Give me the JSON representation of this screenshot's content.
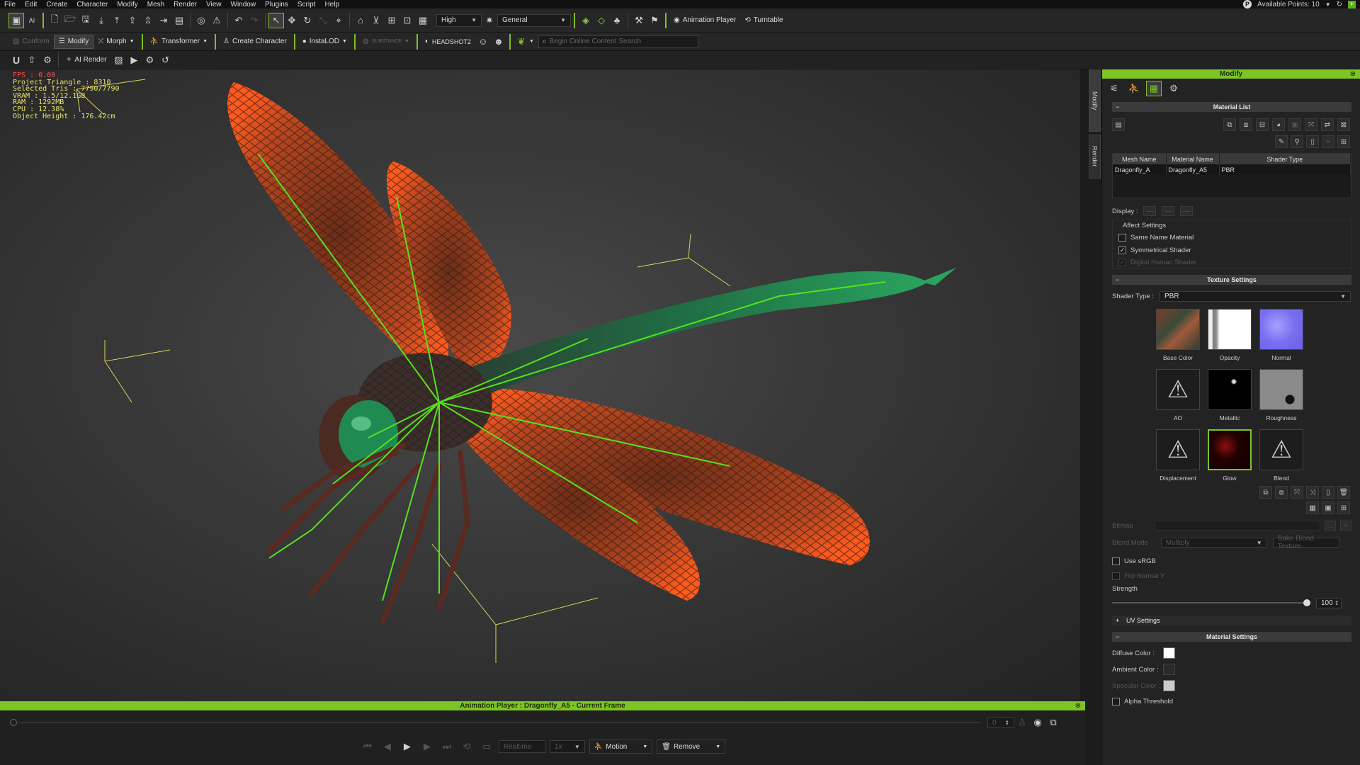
{
  "menu": [
    "File",
    "Edit",
    "Create",
    "Character",
    "Modify",
    "Mesh",
    "Render",
    "View",
    "Window",
    "Plugins",
    "Script",
    "Help"
  ],
  "topright": {
    "points_label": "Available Points: 10"
  },
  "toolbar1": {
    "quality": "High",
    "preset": "General",
    "animation_player": "Animation Player",
    "turntable": "Turntable"
  },
  "toolbar2": {
    "conform": "Conform",
    "modify": "Modify",
    "morph": "Morph",
    "transformer": "Transformer",
    "create_character": "Create Character",
    "instalod": "InstaLOD",
    "substance": "SUBSTANCE",
    "headshot": "HEADSHOT2",
    "search_placeholder": "Begin Online Content Search"
  },
  "toolbar3": {
    "ai_render": "AI Render"
  },
  "stats": {
    "fps": "FPS : 0.00",
    "lines": [
      "Project Triangle : 8310",
      "Selected Tris : 7790/7790",
      "VRAM : 1.5/12.1GB",
      "RAM : 1292MB",
      "CPU : 12.38%",
      "Object Height : 176.42cm"
    ]
  },
  "side_tabs": [
    "Modify",
    "Render"
  ],
  "panel": {
    "title": "Modify",
    "material_list": {
      "title": "Material List",
      "columns": [
        "Mesh Name",
        "Material Name",
        "Shader Type"
      ],
      "rows": [
        [
          "Dragonfly_A",
          "Dragonfly_A5",
          "PBR"
        ]
      ]
    },
    "display_label": "Display :",
    "affect_settings": {
      "title": "Affect Settings",
      "items": [
        {
          "label": "Same Name Material",
          "checked": false,
          "enabled": true
        },
        {
          "label": "Symmetrical Shader",
          "checked": true,
          "enabled": true
        },
        {
          "label": "Digital Human Shader",
          "checked": true,
          "enabled": false
        }
      ]
    },
    "texture_settings": {
      "title": "Texture Settings",
      "shader_type_label": "Shader Type :",
      "shader_type": "PBR",
      "slots": [
        "Base Color",
        "Opacity",
        "Normal",
        "AO",
        "Metallic",
        "Roughness",
        "Displacement",
        "Glow",
        "Blend"
      ]
    },
    "bitmap_label": "Bitmap",
    "blend_mode_label": "Blend Mode",
    "blend_mode_value": "Multiply",
    "bake_blend": "Bake Blend Texture",
    "use_srgb": "Use sRGB",
    "flip_normal": "Flip Normal Y",
    "strength_label": "Strength",
    "strength_value": "100",
    "strength": 100,
    "uv_settings": "UV Settings",
    "material_settings": {
      "title": "Material Settings",
      "diffuse": "Diffuse Color :",
      "ambient": "Ambient Color :",
      "specular": "Specular Color :",
      "alpha": "Alpha Threshold"
    }
  },
  "animation_player": {
    "title": "Animation Player : Dragonfly_A5 - Current Frame",
    "frame": "0",
    "realtime": "Realtime",
    "speed": "1x",
    "motion": "Motion",
    "remove": "Remove"
  },
  "colors": {
    "accent": "#7dc524",
    "stats_text": "#e8e66b",
    "fps_text": "#ff4d4d"
  }
}
